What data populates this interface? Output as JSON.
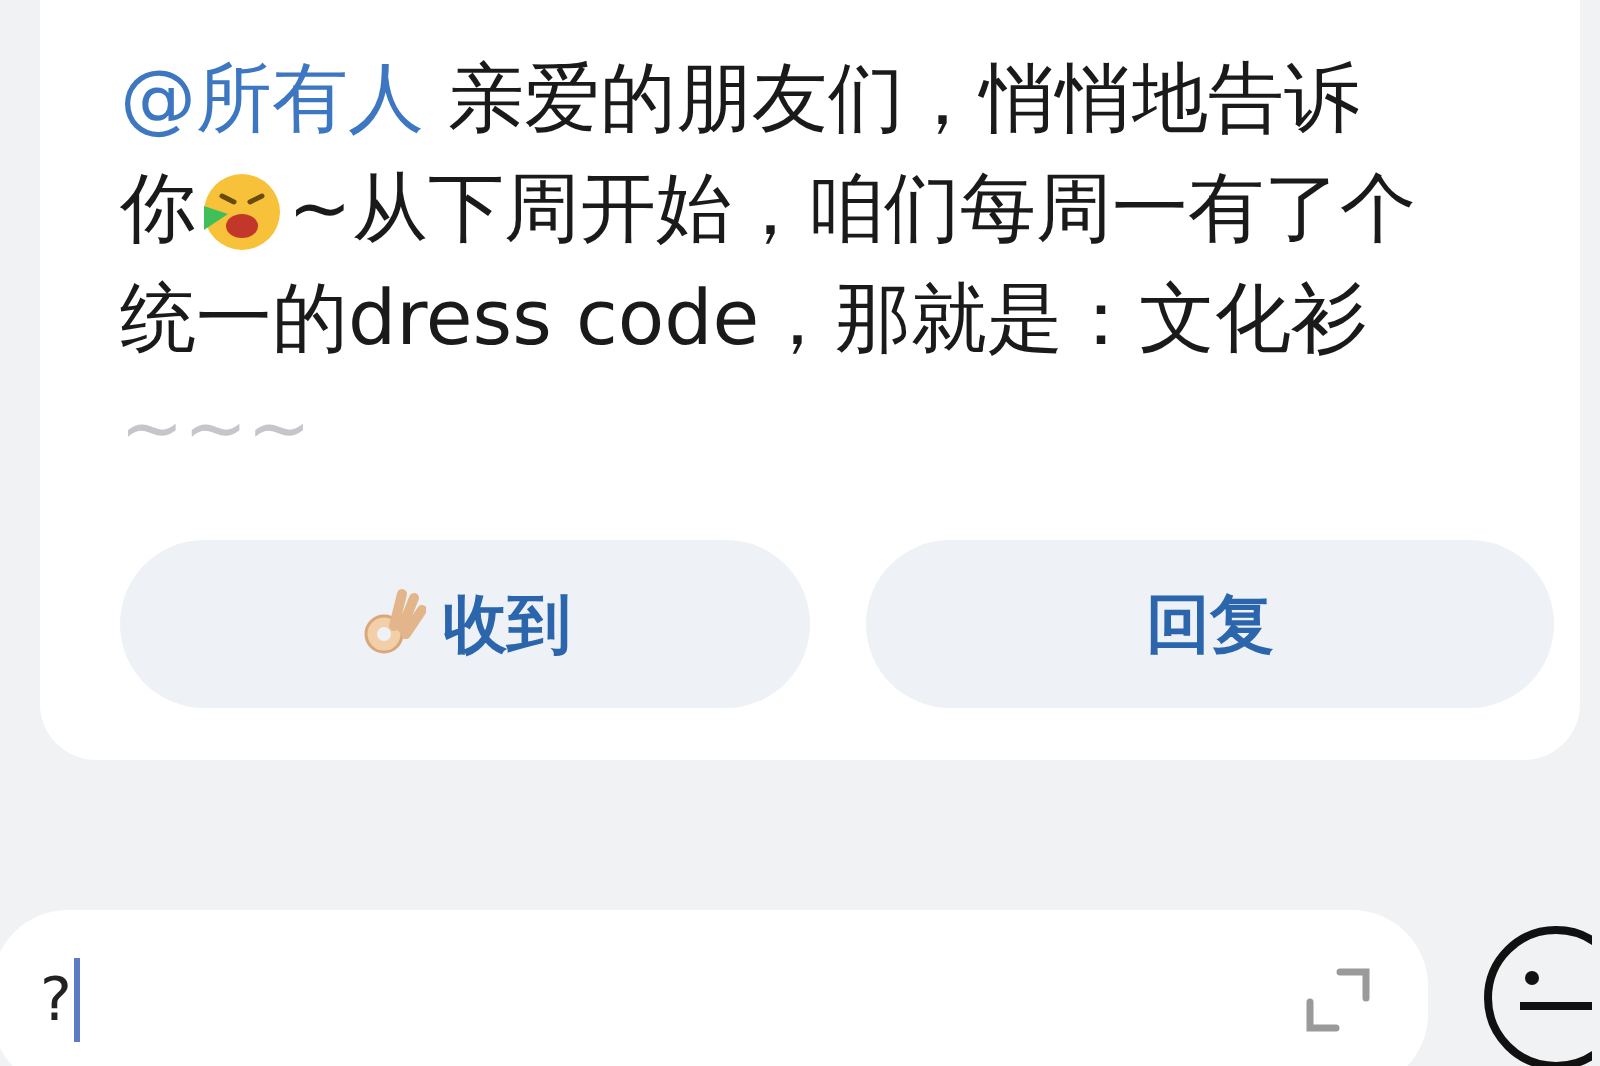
{
  "message": {
    "lines": [
      [
        {
          "kind": "mention",
          "text": "@所有人"
        },
        {
          "kind": "text",
          "text": "亲爱的朋友们，悄悄地告诉"
        }
      ],
      [
        {
          "kind": "text",
          "text": "你"
        },
        {
          "kind": "emoji"
        },
        {
          "kind": "text",
          "text": "~从下周开始，咱们每周一有了个"
        }
      ],
      [
        {
          "kind": "text",
          "text": "统一的dress code，那就是：文化衫"
        }
      ],
      [
        {
          "kind": "faded",
          "text": "~~~"
        }
      ]
    ]
  },
  "actions": [
    {
      "label": "收到",
      "kind": "ok"
    },
    {
      "label": "回复",
      "kind": "plain"
    }
  ],
  "composer": {
    "value": "?"
  }
}
